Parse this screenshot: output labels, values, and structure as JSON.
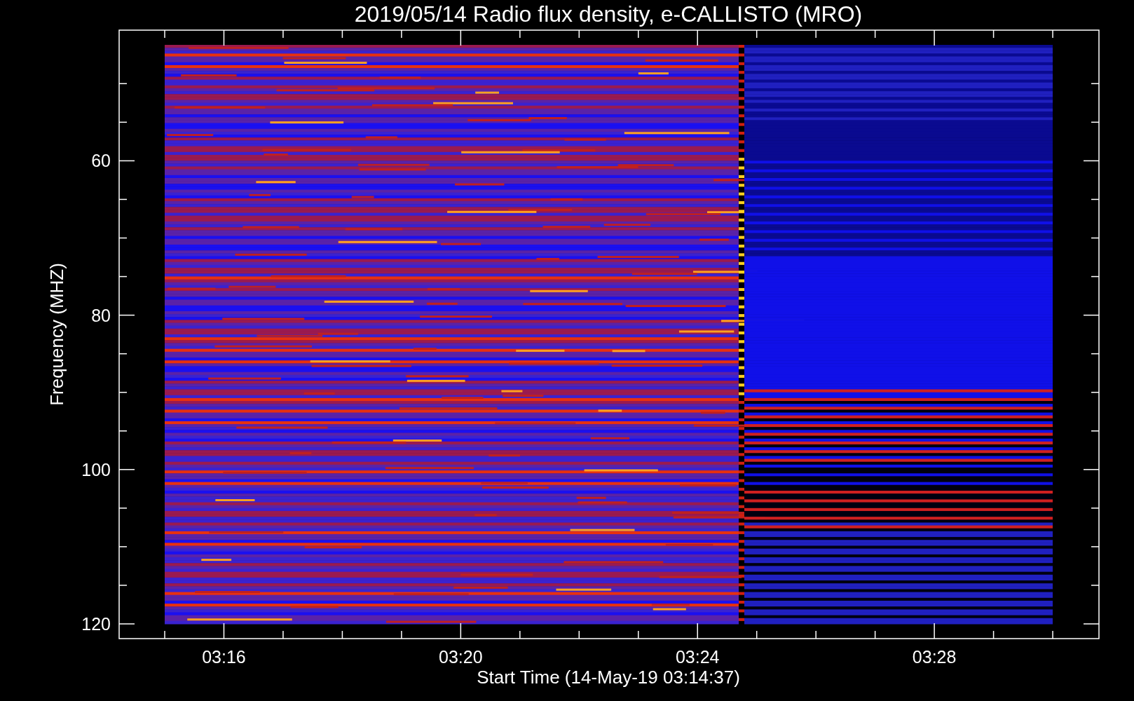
{
  "plot": {
    "title": "2019/05/14  Radio flux density, e-CALLISTO (MRO)",
    "ylabel": "Frequency (MHZ)",
    "xlabel": "Start Time (14-May-19 03:14:37)",
    "yticks": [
      "60",
      "80",
      "100",
      "120"
    ],
    "xticks": [
      "03:16",
      "03:20",
      "03:24",
      "03:28"
    ]
  }
}
